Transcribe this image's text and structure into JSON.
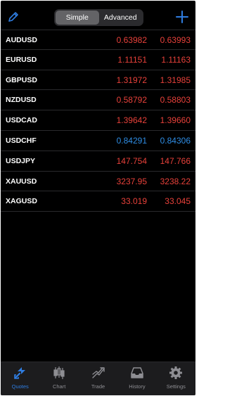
{
  "colors": {
    "accent": "#2f7de1",
    "down": "#e8413a",
    "up": "#2f8de4",
    "inactive": "#8e8e93"
  },
  "header": {
    "edit_icon": "pencil-icon",
    "add_icon": "plus-icon",
    "segments": [
      {
        "label": "Simple",
        "active": true
      },
      {
        "label": "Advanced",
        "active": false
      }
    ]
  },
  "quotes": [
    {
      "symbol": "AUDUSD",
      "bid": "0.63982",
      "ask": "0.63993",
      "direction": "down"
    },
    {
      "symbol": "EURUSD",
      "bid": "1.11151",
      "ask": "1.11163",
      "direction": "down"
    },
    {
      "symbol": "GBPUSD",
      "bid": "1.31972",
      "ask": "1.31985",
      "direction": "down"
    },
    {
      "symbol": "NZDUSD",
      "bid": "0.58792",
      "ask": "0.58803",
      "direction": "down"
    },
    {
      "symbol": "USDCAD",
      "bid": "1.39642",
      "ask": "1.39660",
      "direction": "down"
    },
    {
      "symbol": "USDCHF",
      "bid": "0.84291",
      "ask": "0.84306",
      "direction": "up"
    },
    {
      "symbol": "USDJPY",
      "bid": "147.754",
      "ask": "147.766",
      "direction": "down"
    },
    {
      "symbol": "XAUUSD",
      "bid": "3237.95",
      "ask": "3238.22",
      "direction": "down"
    },
    {
      "symbol": "XAGUSD",
      "bid": "33.019",
      "ask": "33.045",
      "direction": "down"
    }
  ],
  "tabs": [
    {
      "label": "Quotes",
      "icon": "quotes-icon",
      "active": true
    },
    {
      "label": "Chart",
      "icon": "candlestick-chart-icon",
      "active": false
    },
    {
      "label": "Trade",
      "icon": "trade-trend-icon",
      "active": false
    },
    {
      "label": "History",
      "icon": "history-inbox-icon",
      "active": false
    },
    {
      "label": "Settings",
      "icon": "gear-icon",
      "active": false
    }
  ]
}
